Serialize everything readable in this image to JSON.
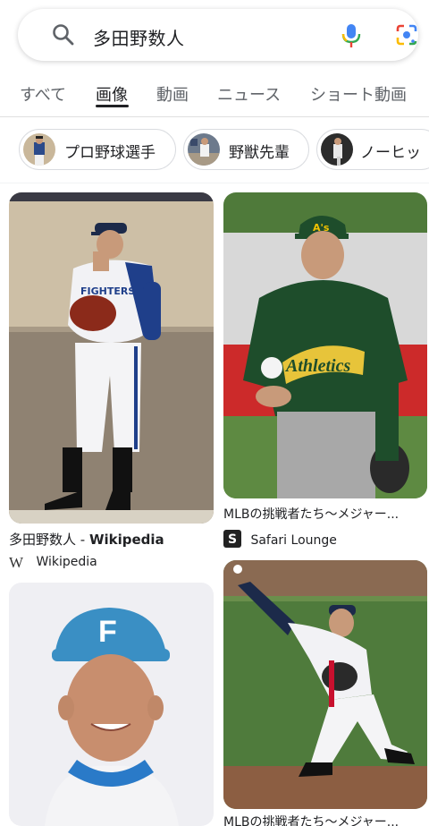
{
  "search": {
    "query": "多田野数人"
  },
  "tabs": [
    "すべて",
    "画像",
    "動画",
    "ニュース",
    "ショート動画"
  ],
  "chips": [
    "プロ野球選手",
    "野獣先輩",
    "ノーヒッ"
  ],
  "results": [
    {
      "title": "多田野数人 - ",
      "title_bold": "Wikipedia",
      "source": "Wikipedia"
    },
    {
      "title": "MLBの挑戦者たち〜メジャー...",
      "source": "Safari Lounge"
    },
    {
      "title": "MLBの挑戦者たち〜メジャー..."
    }
  ],
  "icons": {
    "search": "search-icon",
    "mic": "microphone-icon",
    "lens": "google-lens-icon",
    "wikipedia": "wikipedia-logo-icon",
    "safari_lounge": "safari-lounge-logo-icon"
  },
  "colors": {
    "google_blue": "#4285f4",
    "google_red": "#ea4335",
    "google_yellow": "#fbbc04",
    "google_green": "#34a853"
  }
}
